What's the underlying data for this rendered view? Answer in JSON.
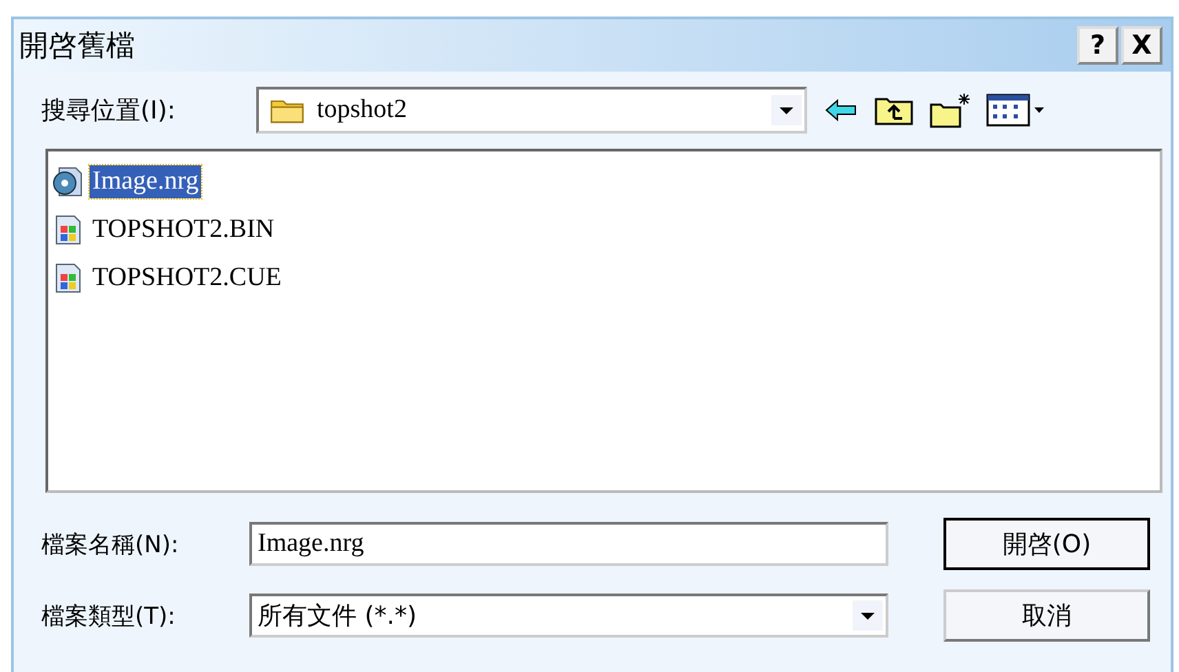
{
  "window": {
    "title": "開啓舊檔",
    "buttons": [
      "?",
      "X"
    ]
  },
  "location": {
    "label": "搜尋位置(I):",
    "value": "topshot2"
  },
  "files": [
    {
      "name": "Image.nrg",
      "kind": "disc",
      "selected": true
    },
    {
      "name": "TOPSHOT2.BIN",
      "kind": "app",
      "selected": false
    },
    {
      "name": "TOPSHOT2.CUE",
      "kind": "app",
      "selected": false
    }
  ],
  "filename": {
    "label": "檔案名稱(N):",
    "value": "Image.nrg"
  },
  "filetype": {
    "label": "檔案類型(T):",
    "value": "所有文件 (*.*)"
  },
  "buttons": [
    {
      "label": "開啓(O)",
      "default": true
    },
    {
      "label": "取消",
      "default": false
    }
  ]
}
